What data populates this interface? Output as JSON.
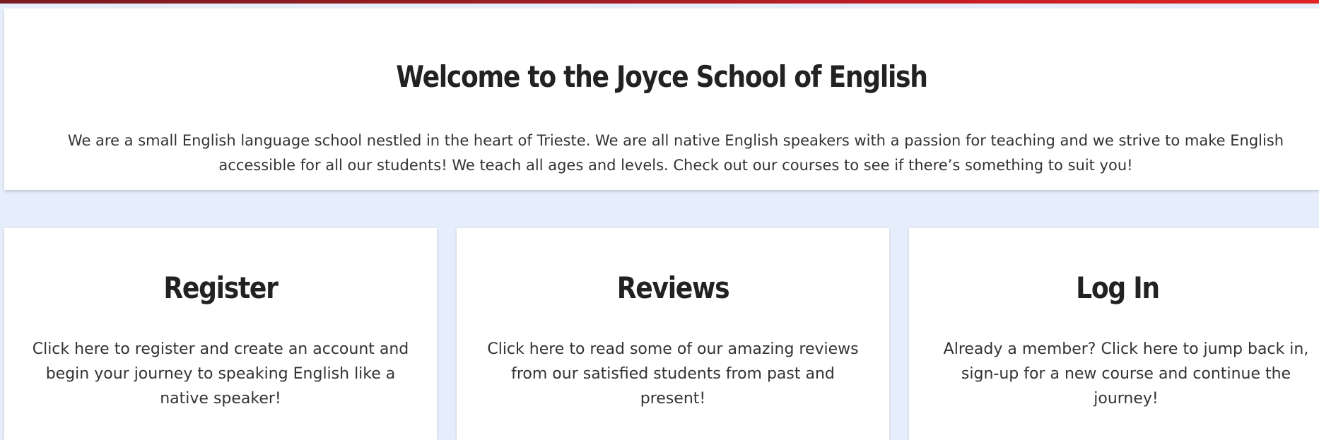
{
  "colors": {
    "accent_bar": "#c81e24",
    "page_background": "#e7eefb",
    "card_background": "#ffffff",
    "text": "#222222"
  },
  "welcome": {
    "title": "Welcome to the Joyce School of English",
    "text": "We are a small English language school nestled in the heart of Trieste. We are all native English speakers with a passion for teaching and we strive to make English accessible for all our students! We teach all ages and levels. Check out our courses to see if there’s something to suit you!"
  },
  "cards": [
    {
      "title": "Register",
      "text": "Click here to register and create an account and begin your journey to speaking English like a native speaker!"
    },
    {
      "title": "Reviews",
      "text": "Click here to read some of our amazing reviews from our satisfied students from past and present!"
    },
    {
      "title": "Log In",
      "text": "Already a member? Click here to jump back in, sign-up for a new course and continue the journey!"
    }
  ]
}
